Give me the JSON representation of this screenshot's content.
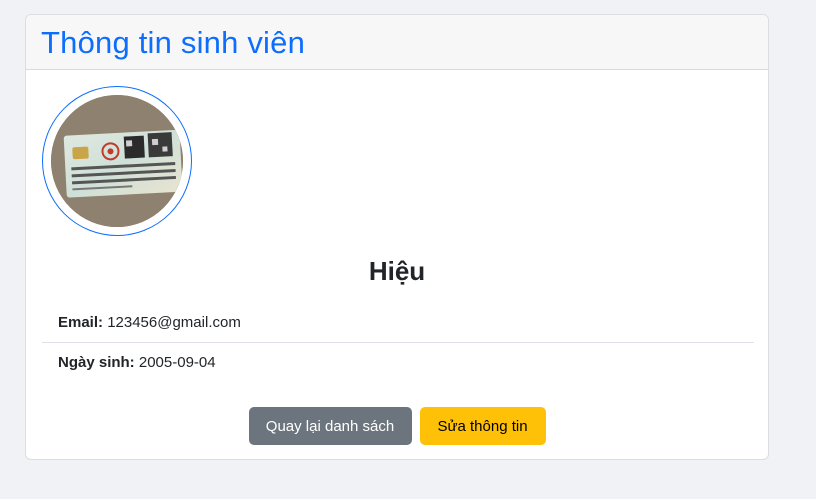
{
  "header": {
    "title": "Thông tin sinh viên"
  },
  "student": {
    "name": "Hiệu",
    "email_label": "Email:",
    "email": "123456@gmail.com",
    "dob_label": "Ngày sinh:",
    "dob": "2005-09-04"
  },
  "actions": {
    "back_label": "Quay lại danh sách",
    "edit_label": "Sửa thông tin"
  },
  "colors": {
    "accent": "#0d6efd",
    "secondary": "#6c757d",
    "warning": "#ffc107"
  }
}
